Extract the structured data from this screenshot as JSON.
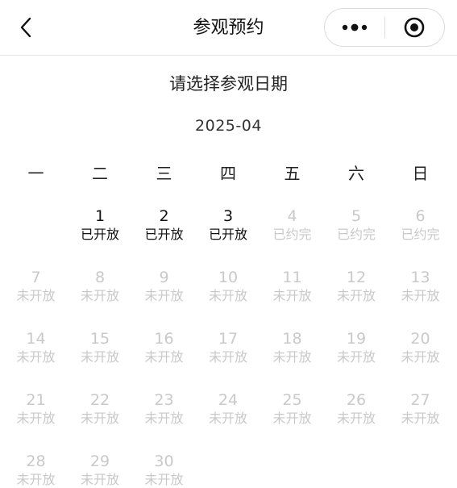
{
  "header": {
    "title": "参观预约",
    "back_icon": "chevron-left-icon",
    "more_icon": "more-dots-icon",
    "close_icon": "target-circle-icon"
  },
  "prompt": "请选择参观日期",
  "month": "2025-04",
  "weekdays": [
    "一",
    "二",
    "三",
    "四",
    "五",
    "六",
    "日"
  ],
  "first_weekday_offset": 1,
  "colors": {
    "open": "#111111",
    "closed": "#c9c9c9"
  },
  "days": [
    {
      "num": "1",
      "status": "已开放",
      "state": "open"
    },
    {
      "num": "2",
      "status": "已开放",
      "state": "open"
    },
    {
      "num": "3",
      "status": "已开放",
      "state": "open"
    },
    {
      "num": "4",
      "status": "已约完",
      "state": "closed"
    },
    {
      "num": "5",
      "status": "已约完",
      "state": "closed"
    },
    {
      "num": "6",
      "status": "已约完",
      "state": "closed"
    },
    {
      "num": "7",
      "status": "未开放",
      "state": "closed"
    },
    {
      "num": "8",
      "status": "未开放",
      "state": "closed"
    },
    {
      "num": "9",
      "status": "未开放",
      "state": "closed"
    },
    {
      "num": "10",
      "status": "未开放",
      "state": "closed"
    },
    {
      "num": "11",
      "status": "未开放",
      "state": "closed"
    },
    {
      "num": "12",
      "status": "未开放",
      "state": "closed"
    },
    {
      "num": "13",
      "status": "未开放",
      "state": "closed"
    },
    {
      "num": "14",
      "status": "未开放",
      "state": "closed"
    },
    {
      "num": "15",
      "status": "未开放",
      "state": "closed"
    },
    {
      "num": "16",
      "status": "未开放",
      "state": "closed"
    },
    {
      "num": "17",
      "status": "未开放",
      "state": "closed"
    },
    {
      "num": "18",
      "status": "未开放",
      "state": "closed"
    },
    {
      "num": "19",
      "status": "未开放",
      "state": "closed"
    },
    {
      "num": "20",
      "status": "未开放",
      "state": "closed"
    },
    {
      "num": "21",
      "status": "未开放",
      "state": "closed"
    },
    {
      "num": "22",
      "status": "未开放",
      "state": "closed"
    },
    {
      "num": "23",
      "status": "未开放",
      "state": "closed"
    },
    {
      "num": "24",
      "status": "未开放",
      "state": "closed"
    },
    {
      "num": "25",
      "status": "未开放",
      "state": "closed"
    },
    {
      "num": "26",
      "status": "未开放",
      "state": "closed"
    },
    {
      "num": "27",
      "status": "未开放",
      "state": "closed"
    },
    {
      "num": "28",
      "status": "未开放",
      "state": "closed"
    },
    {
      "num": "29",
      "status": "未开放",
      "state": "closed"
    },
    {
      "num": "30",
      "status": "未开放",
      "state": "closed"
    }
  ]
}
